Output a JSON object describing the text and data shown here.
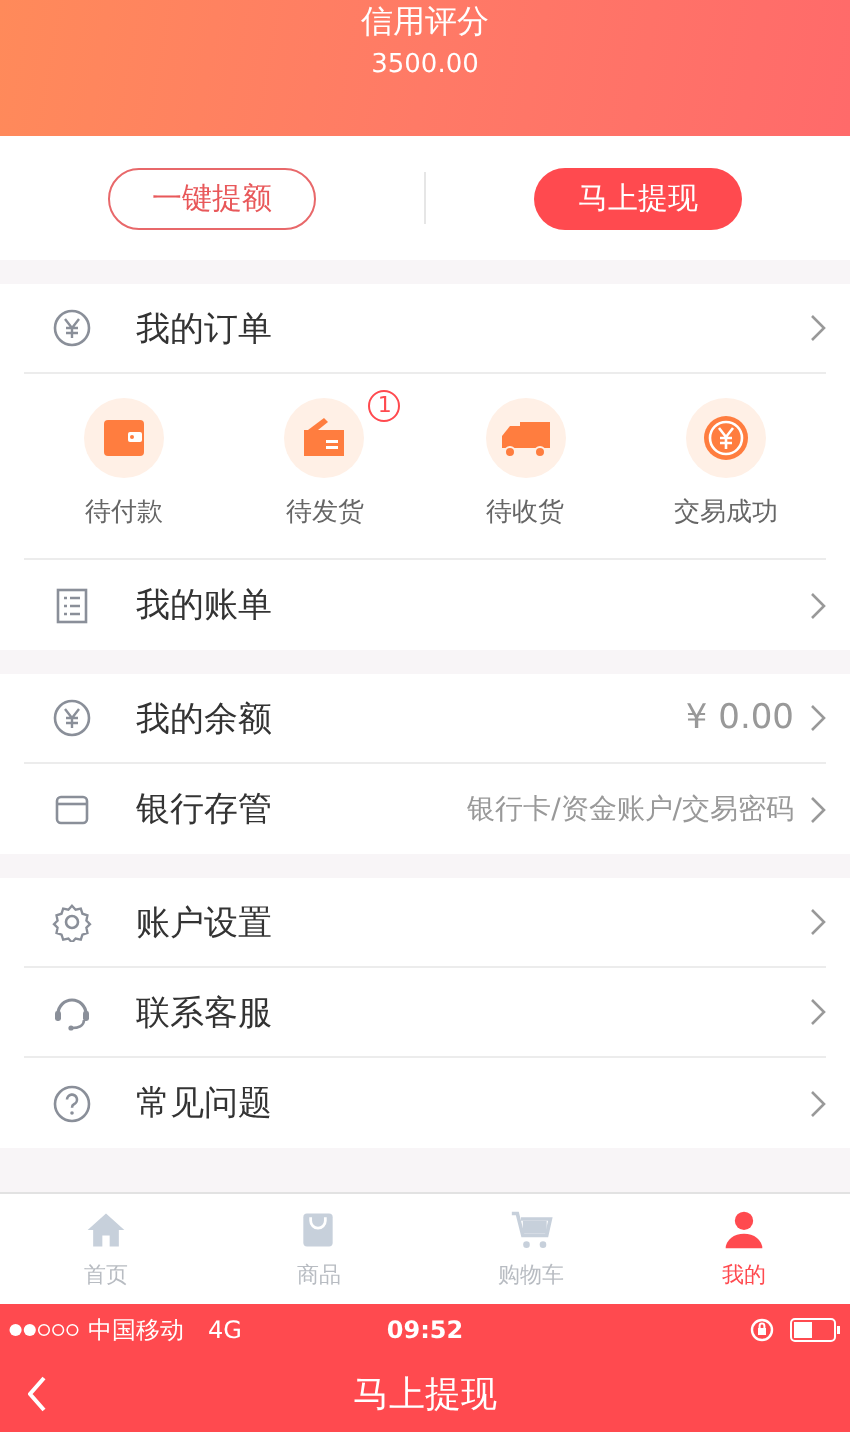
{
  "header": {
    "title": "信用评分",
    "amount": "3500.00"
  },
  "actions": [
    {
      "label": "一键提额",
      "kind": "outline"
    },
    {
      "label": "马上提现",
      "kind": "filled"
    }
  ],
  "order_section": {
    "orders_row": {
      "label": "我的订单"
    },
    "statuses": [
      {
        "label": "待付款"
      },
      {
        "label": "待发货",
        "badge": "1"
      },
      {
        "label": "待收货"
      },
      {
        "label": "交易成功"
      }
    ],
    "bills_row": {
      "label": "我的账单"
    }
  },
  "groups": [
    [
      {
        "label": "我的余额",
        "value": "¥ 0.00"
      },
      {
        "label": "银行存管",
        "value": "银行卡/资金账户/交易密码"
      }
    ],
    [
      {
        "label": "账户设置"
      },
      {
        "label": "联系客服"
      },
      {
        "label": "常见问题"
      }
    ]
  ],
  "tab_bar": [
    {
      "label": "首页",
      "selected": false
    },
    {
      "label": "商品",
      "selected": false
    },
    {
      "label": "购物车",
      "selected": false
    },
    {
      "label": "我的",
      "selected": true
    }
  ],
  "status_bar": {
    "carrier": "中国移动",
    "network": "4G",
    "time": "09:52"
  },
  "nav_bar": {
    "title": "马上提现"
  }
}
